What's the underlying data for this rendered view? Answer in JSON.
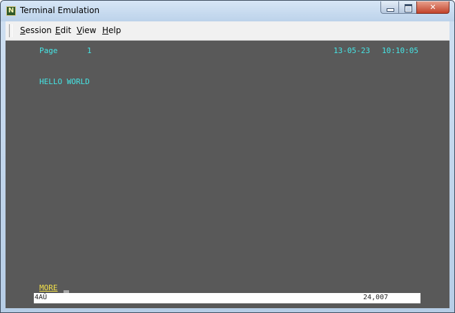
{
  "window": {
    "title": "Terminal Emulation",
    "icon_letter": "N",
    "controls": {
      "minimize": "minimize",
      "maximize": "maximize",
      "close": "✕"
    }
  },
  "menu": {
    "items": [
      {
        "label": "Session",
        "mnemonic": "S"
      },
      {
        "label": "Edit",
        "mnemonic": "E"
      },
      {
        "label": "View",
        "mnemonic": "V"
      },
      {
        "label": "Help",
        "mnemonic": "H"
      }
    ]
  },
  "terminal": {
    "page_label": "Page",
    "page_number": "1",
    "date": "13-05-23",
    "time": "10:10:05",
    "message": "HELLO WORLD",
    "more_prompt": "MORE",
    "colors": {
      "background": "#595959",
      "text": "#45e6e6",
      "prompt": "#f2e04a"
    }
  },
  "status": {
    "left": "4AÛ",
    "right": "24,007"
  }
}
